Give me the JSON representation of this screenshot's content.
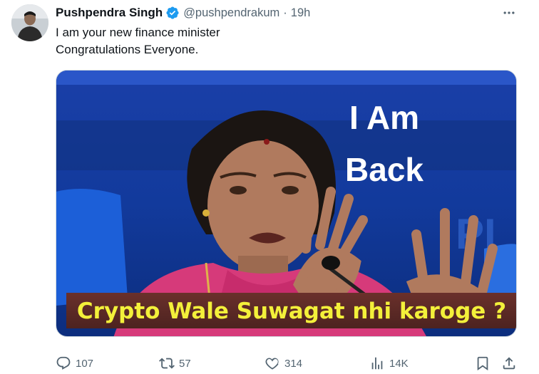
{
  "tweet": {
    "author_name": "Pushpendra Singh",
    "handle": "@pushpendrakum",
    "separator": "·",
    "time": "19h",
    "text_lines": [
      "I am your new finance minister",
      "Congratulations Everyone."
    ],
    "media": {
      "overlay_line1": "I Am",
      "overlay_line2": "Back",
      "caption": "Crypto Wale Suwagat nhi karoge ?"
    },
    "actions": {
      "replies": "107",
      "retweets": "57",
      "likes": "314",
      "views": "14K"
    }
  },
  "icons": {
    "verified": "verified-badge-icon",
    "more": "more-dots-icon",
    "reply": "reply-icon",
    "retweet": "retweet-icon",
    "like": "heart-icon",
    "views": "views-chart-icon",
    "bookmark": "bookmark-icon",
    "share": "share-icon"
  },
  "colors": {
    "verified_blue": "#1d9bf0",
    "secondary_text": "#536471",
    "caption_yellow": "#f3f03a",
    "caption_band": "#5a2a26"
  }
}
